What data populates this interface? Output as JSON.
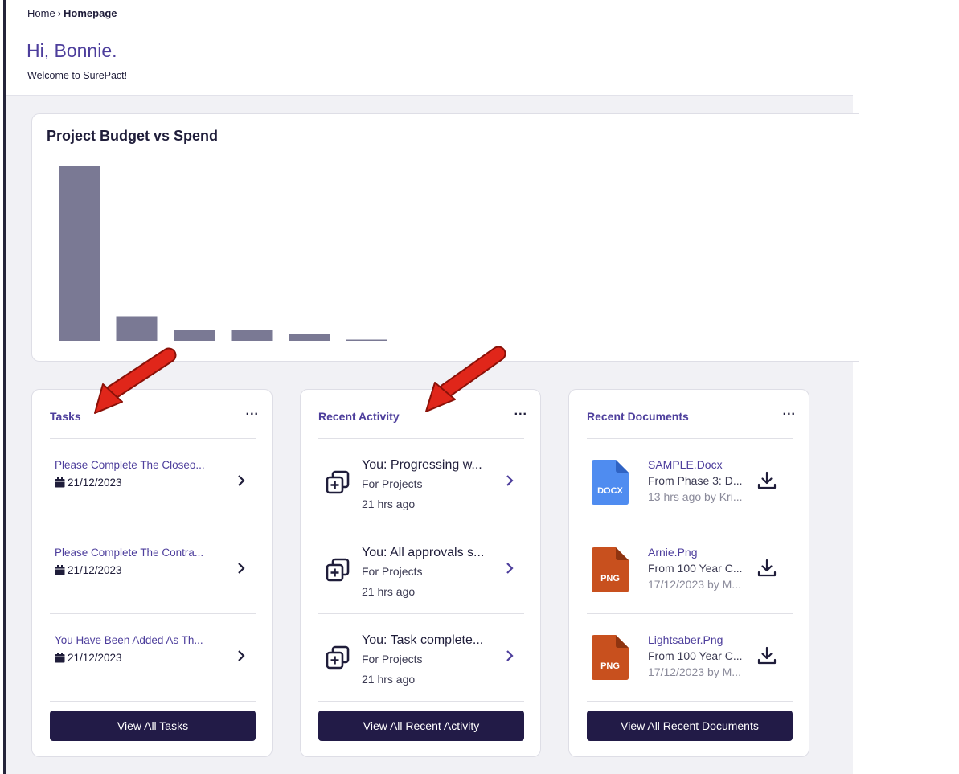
{
  "breadcrumb": {
    "home": "Home",
    "separator": "›",
    "current": "Homepage"
  },
  "greeting": "Hi, Bonnie.",
  "welcome": "Welcome to SurePact!",
  "colors": {
    "accent": "#4d3e9c",
    "button": "#221b47",
    "bar": "#7a7994",
    "annotation_arrow": "#e0261a",
    "docx": "#4f8cf0",
    "png": "#c8501e"
  },
  "chart_data": {
    "type": "bar",
    "title": "Project Budget vs Spend",
    "categories": [
      "",
      "",
      "",
      "",
      "",
      ""
    ],
    "values": [
      100,
      14,
      6,
      6,
      4,
      0.5
    ],
    "xlabel": "",
    "ylabel": "",
    "grid": false
  },
  "tasks": {
    "title": "Tasks",
    "more": "...",
    "items": [
      {
        "title": "Please Complete The Closeo...",
        "date": "21/12/2023"
      },
      {
        "title": "Please Complete The Contra...",
        "date": "21/12/2023"
      },
      {
        "title": "You Have Been Added As Th...",
        "date": "21/12/2023"
      }
    ],
    "button": "View All Tasks"
  },
  "activity": {
    "title": "Recent Activity",
    "more": "...",
    "items": [
      {
        "title": "You: Progressing w...",
        "sub": "For Projects",
        "time": "21 hrs ago",
        "icon": "add-copy-icon"
      },
      {
        "title": "You: All approvals s...",
        "sub": "For Projects",
        "time": "21 hrs ago",
        "icon": "add-copy-icon"
      },
      {
        "title": "You: Task complete...",
        "sub": "For Projects",
        "time": "21 hrs ago",
        "icon": "add-copy-icon"
      }
    ],
    "button": "View All Recent Activity"
  },
  "documents": {
    "title": "Recent Documents",
    "more": "...",
    "items": [
      {
        "name": "SAMPLE.Docx",
        "sub": "From Phase 3: D...",
        "time": "13 hrs ago by Kri...",
        "type": "DOCX",
        "icon": "docx-file-icon"
      },
      {
        "name": "Arnie.Png",
        "sub": "From 100 Year C...",
        "time": "17/12/2023 by M...",
        "type": "PNG",
        "icon": "png-file-icon"
      },
      {
        "name": "Lightsaber.Png",
        "sub": "From 100 Year C...",
        "time": "17/12/2023 by M...",
        "type": "PNG",
        "icon": "png-file-icon"
      }
    ],
    "button": "View All Recent Documents"
  }
}
